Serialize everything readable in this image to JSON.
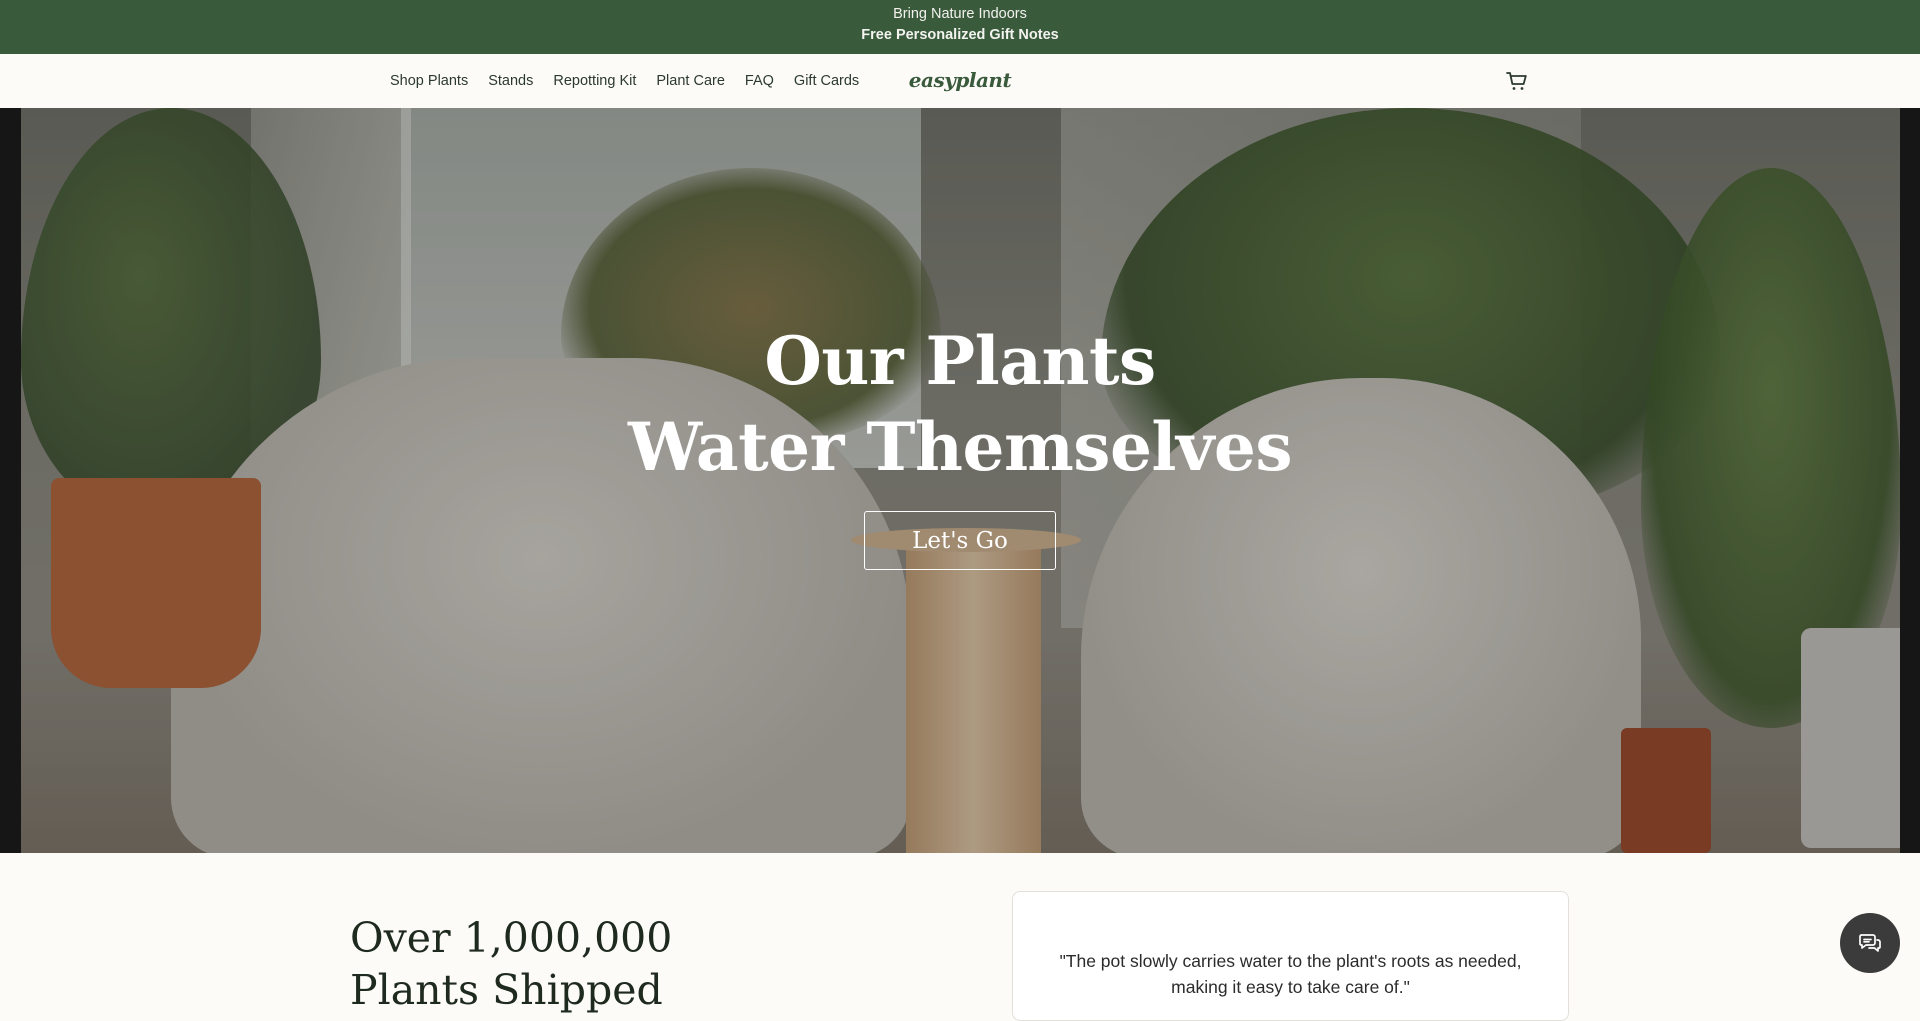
{
  "announcement": {
    "line1": "Bring Nature Indoors",
    "line2": "Free Personalized Gift Notes"
  },
  "nav": {
    "links": [
      "Shop Plants",
      "Stands",
      "Repotting Kit",
      "Plant Care",
      "FAQ",
      "Gift Cards"
    ],
    "logo": "easyplant",
    "cart_icon": "cart-icon"
  },
  "hero": {
    "title_line1": "Our Plants",
    "title_line2": "Water Themselves",
    "cta_label": "Let's Go"
  },
  "stats": {
    "line1": "Over 1,000,000",
    "line2": "Plants Shipped"
  },
  "testimonial": {
    "quote": "\"The pot slowly carries water to the plant's roots as needed, making it easy to take care of.\""
  },
  "chat": {
    "icon": "chat-icon"
  },
  "colors": {
    "brand_green": "#3a5a3c",
    "background": "#fdfbf8"
  }
}
